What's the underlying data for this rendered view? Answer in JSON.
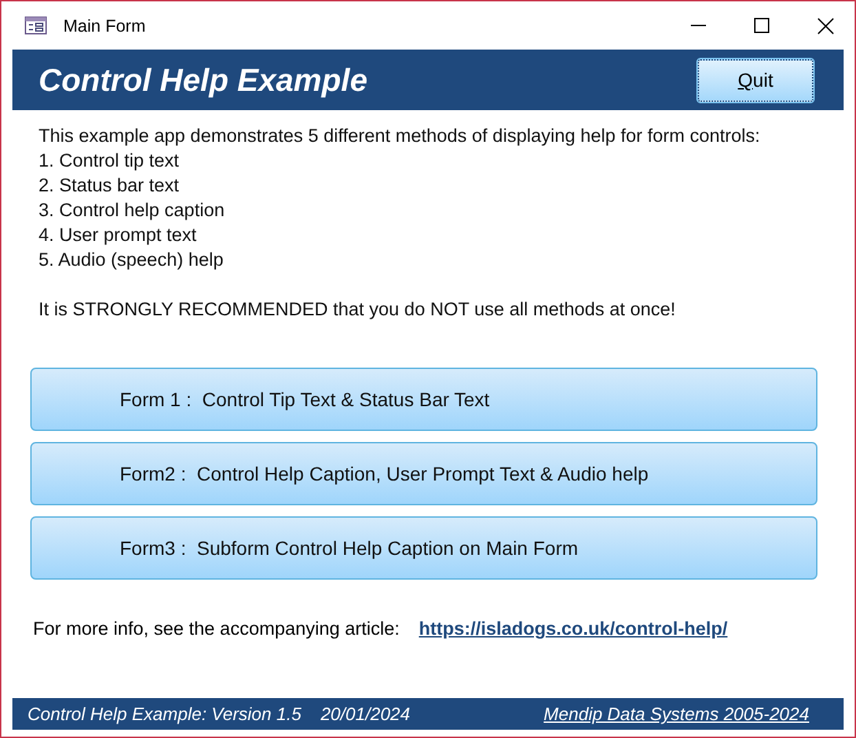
{
  "window": {
    "title": "Main Form"
  },
  "header": {
    "title": "Control Help Example",
    "quit_button": "Quit"
  },
  "intro": {
    "lines": [
      "This example app demonstrates 5 different methods of displaying help for form controls:",
      "1. Control tip text",
      "2. Status bar text",
      "3. Control help caption",
      "4. User prompt text",
      "5. Audio (speech) help"
    ],
    "warning": "It is STRONGLY RECOMMENDED that you do NOT use all methods at once!"
  },
  "form_buttons": [
    "Form 1 :  Control Tip Text & Status Bar Text",
    "Form2 :  Control Help Caption, User Prompt Text & Audio help",
    "Form3 :  Subform Control Help Caption on Main Form"
  ],
  "more_info": {
    "label": "For more info, see the accompanying article:",
    "link": "https://isladogs.co.uk/control-help/"
  },
  "footer": {
    "version": "Control Help Example:  Version 1.5",
    "date": "20/01/2024",
    "copyright": "Mendip Data Systems 2005-2024"
  }
}
